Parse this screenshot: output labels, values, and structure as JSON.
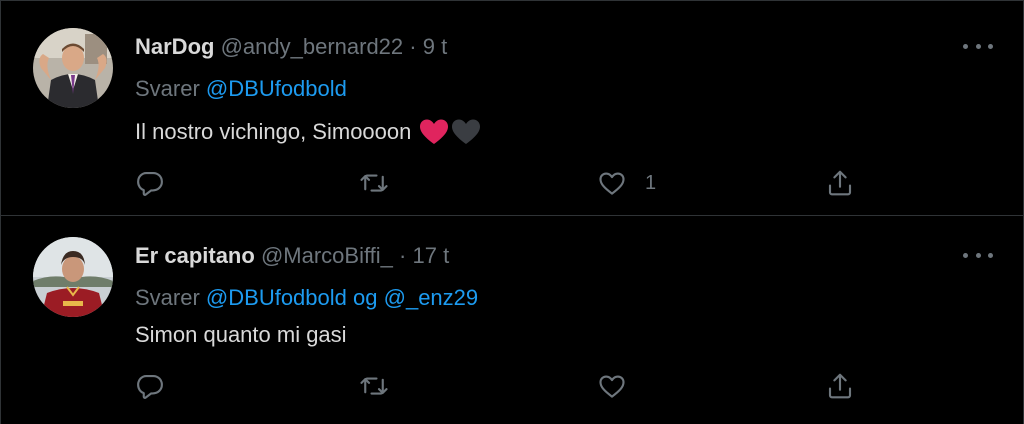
{
  "tweets": [
    {
      "name": "NarDog",
      "handle": "@andy_bernard22",
      "separator": "·",
      "time": "9 t",
      "reply_prefix": "Svarer",
      "mentions": [
        "@DBUfodbold"
      ],
      "mention_joiner": "",
      "text": "Il nostro vichingo, Simoooon",
      "emojis": [
        "red-heart",
        "black-heart"
      ],
      "like_count": "1",
      "avatar": "nardog-avatar"
    },
    {
      "name": "Er capitano",
      "handle": "@MarcoBiffi_",
      "separator": "·",
      "time": "17 t",
      "reply_prefix": "Svarer",
      "mentions": [
        "@DBUfodbold",
        "@_enz29"
      ],
      "mention_joiner": "og",
      "text": "Simon quanto mi gasi",
      "emojis": [],
      "like_count": "",
      "avatar": "ercapitano-avatar"
    }
  ],
  "icons": {
    "more": "more-icon",
    "reply": "reply-icon",
    "retweet": "retweet-icon",
    "like": "like-icon",
    "share": "share-icon"
  },
  "colors": {
    "background": "#000000",
    "text": "#d9d9d9",
    "muted": "#6e767d",
    "link": "#1d9bf0",
    "border": "#2f3336",
    "heart_red": "#e0245e"
  }
}
